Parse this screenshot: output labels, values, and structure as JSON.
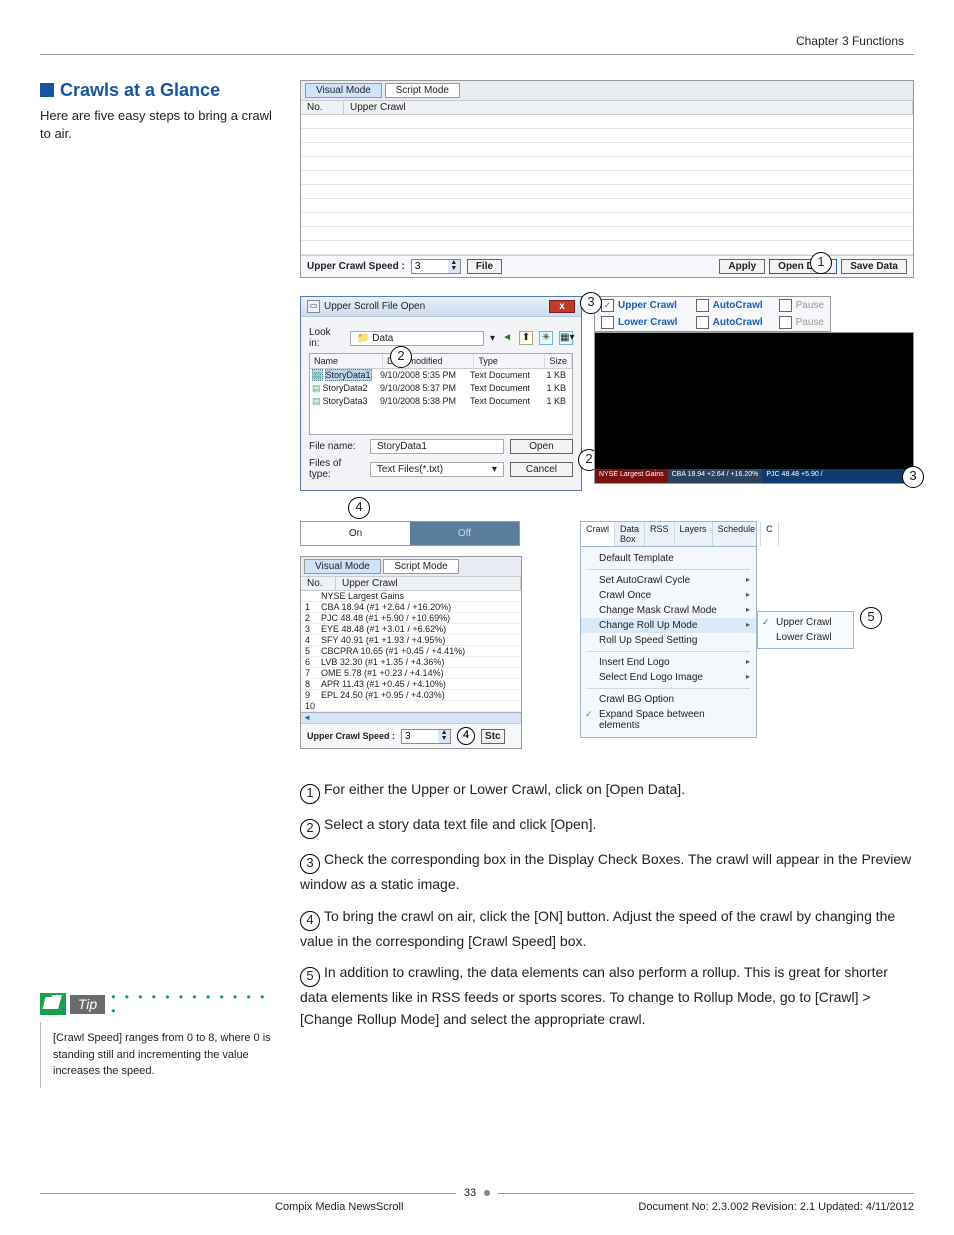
{
  "header": {
    "chapter": "Chapter 3 Functions"
  },
  "title": "Crawls at a Glance",
  "intro": "Here are five easy steps to bring a crawl to air.",
  "panel1": {
    "tab_visual": "Visual Mode",
    "tab_script": "Script Mode",
    "col_no": "No.",
    "col_upper": "Upper Crawl",
    "speed_label": "Upper Crawl Speed :",
    "speed_value": "3",
    "file_btn": "File",
    "apply": "Apply",
    "open_data": "Open Data",
    "save_data": "Save Data"
  },
  "dlg": {
    "title": "Upper Scroll File Open",
    "lookin": "Look in:",
    "folder": "Data",
    "h_name": "Name",
    "h_date": "Date modified",
    "h_type": "Type",
    "h_size": "Size",
    "files": [
      {
        "name": "StoryData1",
        "date": "9/10/2008 5:35 PM",
        "type": "Text Document",
        "size": "1 KB"
      },
      {
        "name": "StoryData2",
        "date": "9/10/2008 5:37 PM",
        "type": "Text Document",
        "size": "1 KB"
      },
      {
        "name": "StoryData3",
        "date": "9/10/2008 5:38 PM",
        "type": "Text Document",
        "size": "1 KB"
      }
    ],
    "fn_label": "File name:",
    "fn_value": "StoryData1",
    "ft_label": "Files of type:",
    "ft_value": "Text Files(*.txt)",
    "open": "Open",
    "cancel": "Cancel"
  },
  "checks": {
    "upper": "Upper Crawl",
    "lower": "Lower Crawl",
    "auto": "AutoCrawl",
    "pause": "Pause"
  },
  "ticker": {
    "t1": "NYSE Largest Gains",
    "t2": "CBA 18.94 +2.64 / +16.20%",
    "t3": "PJC 48.48 +5.90 /"
  },
  "onoff": {
    "on": "On",
    "off": "Off"
  },
  "data_panel": {
    "tab_visual": "Visual Mode",
    "tab_script": "Script Mode",
    "col_no": "No.",
    "col_upper": "Upper Crawl",
    "rows": [
      {
        "n": "",
        "t": "NYSE Largest Gains"
      },
      {
        "n": "1",
        "t": "CBA 18.94 (#1 +2.64 / +16.20%)"
      },
      {
        "n": "2",
        "t": "PJC 48.48 (#1 +5.90 / +10.69%)"
      },
      {
        "n": "3",
        "t": "EYE 48.48 (#1 +3.01 / +6.62%)"
      },
      {
        "n": "4",
        "t": "SFY 40.91 (#1 +1.93 / +4.95%)"
      },
      {
        "n": "5",
        "t": "CBCPRA 10.65 (#1 +0.45 / +4.41%)"
      },
      {
        "n": "6",
        "t": "LVB 32.30 (#1 +1.35 / +4.36%)"
      },
      {
        "n": "7",
        "t": "OME 5.78 (#1 +0.23 / +4.14%)"
      },
      {
        "n": "8",
        "t": "APR 11.43 (#1 +0.45 / +4.10%)"
      },
      {
        "n": "9",
        "t": "EPL 24.50 (#1 +0.95 / +4.03%)"
      },
      {
        "n": "10",
        "t": ""
      }
    ],
    "speed_label": "Upper Crawl Speed :",
    "speed_value": "3",
    "suffix": "Stc"
  },
  "menu": {
    "tabs": [
      "Crawl",
      "Data Box",
      "RSS",
      "Layers",
      "Schedule",
      "C"
    ],
    "default": "Default Template",
    "items1": [
      "Set AutoCrawl Cycle",
      "Crawl Once",
      "Change Mask Crawl Mode",
      "Change Roll Up Mode",
      "Roll Up Speed Setting"
    ],
    "items2": [
      "Insert End Logo",
      "Select End Logo Image"
    ],
    "items3": [
      "Crawl BG Option",
      "Expand Space between elements"
    ],
    "sub_upper": "Upper Crawl",
    "sub_lower": "Lower Crawl"
  },
  "steps": {
    "s1": "For either the Upper or Lower Crawl, click on [Open Data].",
    "s2": "Select a story data text file and click [Open].",
    "s3": "Check the corresponding box in the Display Check Boxes. The crawl will appear in the Preview window as a static image.",
    "s4": "To bring the crawl on air, click the [ON] button. Adjust the speed of the crawl by changing the value in the corresponding [Crawl Speed] box.",
    "s5": "In addition to crawling, the data elements can also perform a rollup. This is great for shorter data elements like in RSS feeds or sports scores. To change to Rollup Mode, go to [Crawl] > [Change Rollup Mode] and select the appropriate crawl."
  },
  "tip": {
    "label": "Tip",
    "body": "[Crawl Speed] ranges from 0 to 8, where 0 is standing still and incrementing the value increases the speed."
  },
  "footer": {
    "page": "33",
    "product": "Compix Media NewsScroll",
    "doc": "Document No: 2.3.002 Revision: 2.1 Updated: 4/11/2012"
  }
}
